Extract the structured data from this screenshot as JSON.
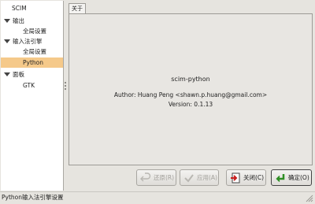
{
  "tree": {
    "root": "SCIM",
    "items": [
      {
        "label": "输出",
        "expanded": true
      },
      {
        "label": "全局设置"
      },
      {
        "label": "输入法引擎",
        "expanded": true
      },
      {
        "label": "全局设置"
      },
      {
        "label": "Python",
        "selected": true
      },
      {
        "label": "面板",
        "expanded": true
      },
      {
        "label": "GTK"
      }
    ]
  },
  "tab": {
    "label": "关于"
  },
  "about": {
    "name": "scim-python",
    "author": "Author: Huang Peng <shawn.p.huang@gmail.com>",
    "version": "Version: 0.1.13"
  },
  "buttons": {
    "restore": "还原(R)",
    "apply": "应用(A)",
    "close": "关闭(C)",
    "ok": "确定(O)"
  },
  "status": {
    "text": "Python输入法引擎设置"
  },
  "colors": {
    "selection": "#f5c98a"
  }
}
